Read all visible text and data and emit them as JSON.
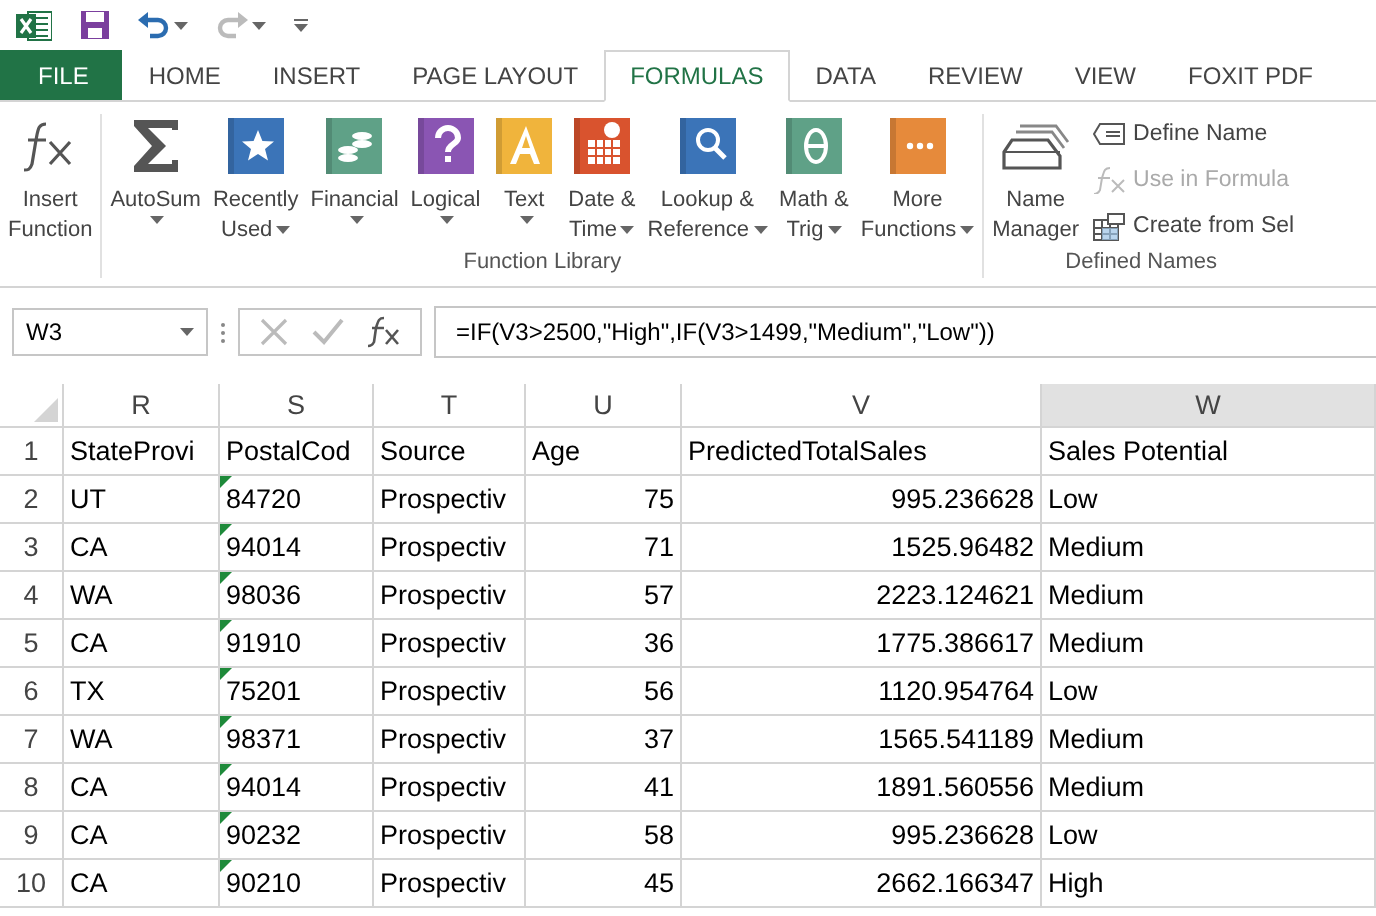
{
  "quick_access": [
    {
      "kind": "app"
    },
    {
      "kind": "save",
      "disabled": false
    },
    {
      "kind": "undo",
      "disabled": false
    },
    {
      "kind": "redo",
      "disabled": true
    },
    {
      "kind": "customize"
    }
  ],
  "tabs": [
    {
      "label": "FILE",
      "kind": "file",
      "selected": false
    },
    {
      "label": "HOME",
      "kind": "tab",
      "selected": false
    },
    {
      "label": "INSERT",
      "kind": "tab",
      "selected": false
    },
    {
      "label": "PAGE LAYOUT",
      "kind": "tab",
      "selected": false
    },
    {
      "label": "FORMULAS",
      "kind": "tab",
      "selected": true
    },
    {
      "label": "DATA",
      "kind": "tab",
      "selected": false
    },
    {
      "label": "REVIEW",
      "kind": "tab",
      "selected": false
    },
    {
      "label": "VIEW",
      "kind": "tab",
      "selected": false
    },
    {
      "label": "FOXIT PDF",
      "kind": "tab",
      "selected": false
    }
  ],
  "groups": [
    {
      "buttons": [
        {
          "kind": "fx",
          "lines": [
            "Insert",
            "Function"
          ],
          "dropdown": false
        }
      ]
    },
    {
      "name": "Function Library",
      "buttons": [
        {
          "kind": "sigma",
          "lines": [
            "AutoSum"
          ],
          "dropdown": true
        },
        {
          "kind": "star",
          "lines": [
            "Recently",
            "Used"
          ],
          "dropdown": true
        },
        {
          "kind": "coins",
          "lines": [
            "Financial"
          ],
          "dropdown": true
        },
        {
          "kind": "question",
          "lines": [
            "Logical"
          ],
          "dropdown": true
        },
        {
          "kind": "letter",
          "lines": [
            "Text"
          ],
          "dropdown": true
        },
        {
          "kind": "calendar",
          "lines": [
            "Date &",
            "Time"
          ],
          "dropdown": true
        },
        {
          "kind": "magnifier",
          "lines": [
            "Lookup &",
            "Reference"
          ],
          "dropdown": true
        },
        {
          "kind": "theta",
          "lines": [
            "Math &",
            "Trig"
          ],
          "dropdown": true
        },
        {
          "kind": "dots",
          "lines": [
            "More",
            "Functions"
          ],
          "dropdown": true
        }
      ]
    },
    {
      "name": "Defined Names",
      "buttons": [
        {
          "kind": "names",
          "lines": [
            "Name",
            "Manager"
          ],
          "dropdown": false
        },
        {
          "kind": "tag",
          "label": "Define Name",
          "disabled": false
        },
        {
          "kind": "fx-small",
          "label": "Use in Formula",
          "disabled": true
        },
        {
          "kind": "grid",
          "label": "Create from Sel",
          "disabled": false
        }
      ]
    }
  ],
  "formula_bar": {
    "name_box": "W3",
    "formula": "=IF(V3>2500,\"High\",IF(V3>1499,\"Medium\",\"Low\"))"
  },
  "columns": [
    {
      "letter": "R",
      "kind": "text"
    },
    {
      "letter": "S",
      "kind": "text"
    },
    {
      "letter": "T",
      "kind": "text"
    },
    {
      "letter": "U",
      "kind": "number"
    },
    {
      "letter": "V",
      "kind": "number"
    },
    {
      "letter": "W",
      "kind": "text",
      "selected": true
    }
  ],
  "rows": [
    {
      "number": "1",
      "flagged": false,
      "cells": [
        "StateProvi",
        "PostalCod",
        "Source",
        "Age",
        "PredictedTotalSales",
        "Sales Potential"
      ]
    },
    {
      "number": "2",
      "flagged": true,
      "cells": [
        "UT",
        "84720",
        "Prospectiv",
        "75",
        "995.236628",
        "Low"
      ]
    },
    {
      "number": "3",
      "flagged": true,
      "cells": [
        "CA",
        "94014",
        "Prospectiv",
        "71",
        "1525.96482",
        "Medium"
      ]
    },
    {
      "number": "4",
      "flagged": true,
      "cells": [
        "WA",
        "98036",
        "Prospectiv",
        "57",
        "2223.124621",
        "Medium"
      ]
    },
    {
      "number": "5",
      "flagged": true,
      "cells": [
        "CA",
        "91910",
        "Prospectiv",
        "36",
        "1775.386617",
        "Medium"
      ]
    },
    {
      "number": "6",
      "flagged": true,
      "cells": [
        "TX",
        "75201",
        "Prospectiv",
        "56",
        "1120.954764",
        "Low"
      ]
    },
    {
      "number": "7",
      "flagged": true,
      "cells": [
        "WA",
        "98371",
        "Prospectiv",
        "37",
        "1565.541189",
        "Medium"
      ]
    },
    {
      "number": "8",
      "flagged": true,
      "cells": [
        "CA",
        "94014",
        "Prospectiv",
        "41",
        "1891.560556",
        "Medium"
      ]
    },
    {
      "number": "9",
      "flagged": true,
      "cells": [
        "CA",
        "90232",
        "Prospectiv",
        "58",
        "995.236628",
        "Low"
      ]
    },
    {
      "number": "10",
      "flagged": true,
      "cells": [
        "CA",
        "90210",
        "Prospectiv",
        "45",
        "2662.166347",
        "High"
      ]
    }
  ]
}
